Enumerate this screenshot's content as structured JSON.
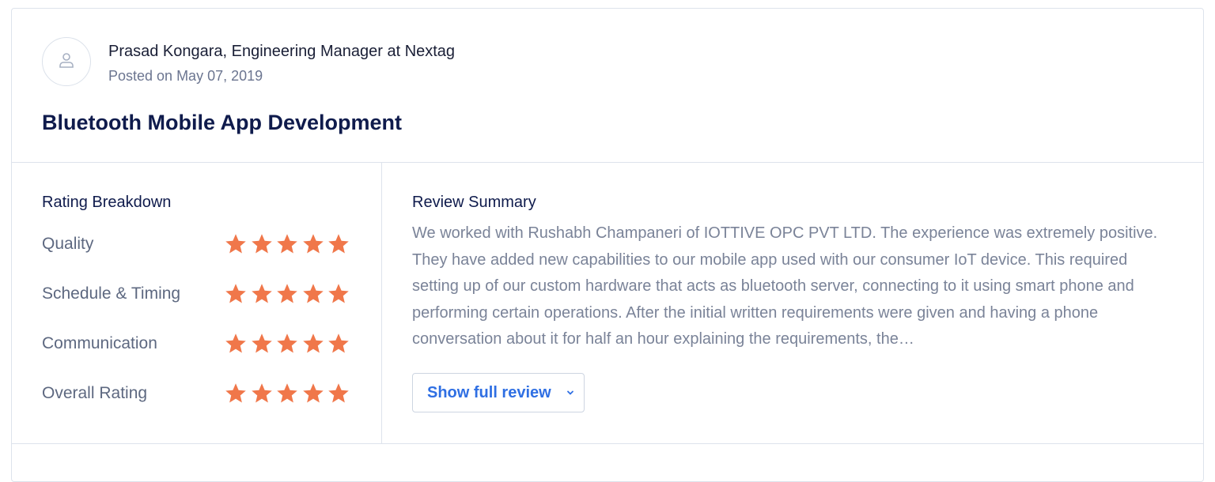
{
  "review": {
    "author": "Prasad Kongara, Engineering Manager at Nextag",
    "posted": "Posted on May 07, 2019",
    "title": "Bluetooth Mobile App Development"
  },
  "rating_breakdown": {
    "heading": "Rating Breakdown",
    "star_color": "#f0774a",
    "items": [
      {
        "label": "Quality",
        "stars": 5,
        "max": 5
      },
      {
        "label": "Schedule & Timing",
        "stars": 5,
        "max": 5
      },
      {
        "label": "Communication",
        "stars": 5,
        "max": 5
      },
      {
        "label": "Overall Rating",
        "stars": 5,
        "max": 5
      }
    ]
  },
  "summary": {
    "heading": "Review Summary",
    "text": "We worked with Rushabh Champaneri of IOTTIVE OPC PVT LTD. The experience was extremely positive. They have added new capabilities to our mobile app used with our consumer IoT device. This required setting up of our custom hardware that acts as bluetooth server, connecting to it using smart phone and performing certain operations. After the initial written requirements were given and having a phone conversation about it for half an hour explaining the requirements, the…",
    "button_label": "Show full review"
  },
  "icons": {
    "avatar": "user-icon",
    "star": "star-icon",
    "chevron": "chevron-down-icon"
  },
  "colors": {
    "accent": "#2f6fe3",
    "title": "#0f1b4c",
    "muted": "#7a8398"
  }
}
